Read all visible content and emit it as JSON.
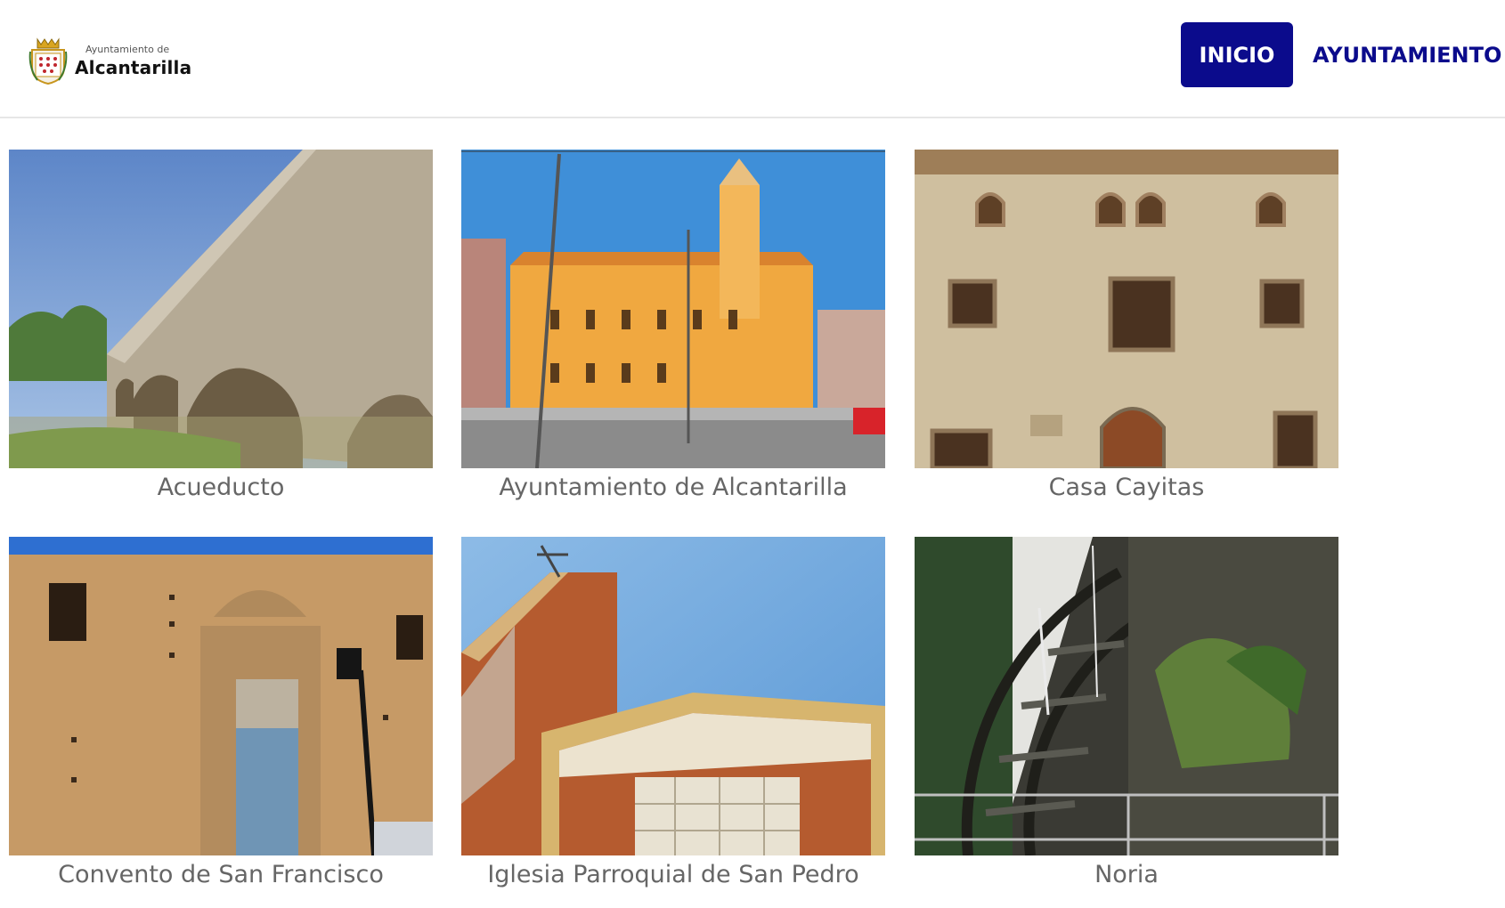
{
  "header": {
    "logo": {
      "line1": "Ayuntamiento de",
      "line2": "Alcantarilla",
      "icon": "coat-of-arms-icon"
    },
    "nav": [
      {
        "label": "INICIO",
        "active": true
      },
      {
        "label": "AYUNTAMIENTO",
        "active": false
      }
    ]
  },
  "colors": {
    "nav_active_bg": "#0b0b8c",
    "nav_text": "#0b0b8c",
    "caption": "#666666"
  },
  "gallery": [
    {
      "caption": "Acueducto"
    },
    {
      "caption": "Ayuntamiento de Alcantarilla"
    },
    {
      "caption": "Casa Cayitas"
    },
    {
      "caption": "Convento de San Francisco"
    },
    {
      "caption": "Iglesia Parroquial de San Pedro"
    },
    {
      "caption": "Noria"
    }
  ]
}
